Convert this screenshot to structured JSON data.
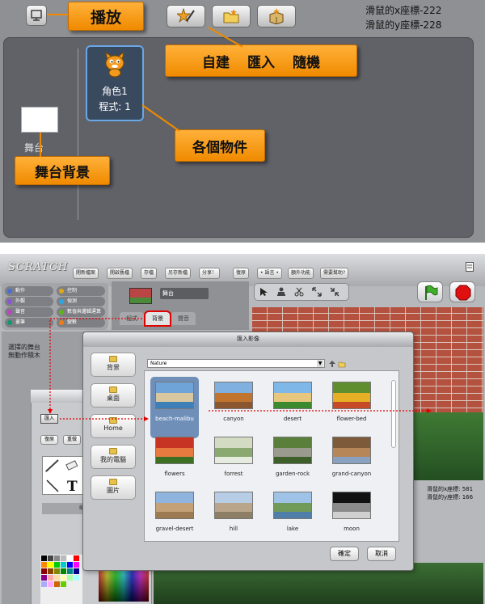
{
  "top": {
    "play_callout": "播放",
    "toolbar_callout": {
      "new": "自建",
      "import": "匯入",
      "random": "隨機"
    },
    "objects_callout": "各個物件",
    "stage_bg_callout": "舞台背景",
    "mouse_x": "滑鼠的x座標-222",
    "mouse_y": "滑鼠的y座標-228",
    "sprite": {
      "name": "角色1",
      "scripts": "程式: 1"
    },
    "stage_label": "舞台"
  },
  "bottom": {
    "logo": "SCRATCH",
    "menu": [
      "開新檔案",
      "開啟舊檔",
      "存檔",
      "另存新檔",
      "分享！",
      "復原",
      "• 語言 •",
      "額外功能",
      "需要幫助?"
    ],
    "categories_left": [
      {
        "label": "動作",
        "color": "#4a6cd4"
      },
      {
        "label": "外觀",
        "color": "#8a55d7"
      },
      {
        "label": "聲音",
        "color": "#bb42c3"
      },
      {
        "label": "畫筆",
        "color": "#0e9a6c"
      }
    ],
    "categories_right": [
      {
        "label": "控制",
        "color": "#e1a91a"
      },
      {
        "label": "偵測",
        "color": "#2ca5e2"
      },
      {
        "label": "數值與邏輯運算",
        "color": "#5cb712"
      },
      {
        "label": "變數",
        "color": "#ee7d16"
      }
    ],
    "stage_name": "舞台",
    "tabs": [
      "程式",
      "背景",
      "聲音"
    ],
    "selected_stage": "選擇的舞台",
    "no_blocks": "無動作積木",
    "import_btn": "匯入",
    "undo_btn": "復原",
    "clear_btn": "重做",
    "zoom_btn": "縮放",
    "mouse_x": "滑鼠的x座標: 581",
    "mouse_y": "滑鼠的y座標: 166",
    "dialog": {
      "title": "匯入影像",
      "folder": "Nature",
      "sidebar": [
        "背景",
        "桌面",
        "Home",
        "我的電腦",
        "圖片"
      ],
      "items": [
        {
          "label": "beach-malibu",
          "colors": [
            "#6fa4d8",
            "#d9c7a0",
            "#3f7fb8"
          ]
        },
        {
          "label": "canyon",
          "colors": [
            "#7fb0e0",
            "#c0742e",
            "#8a5630"
          ]
        },
        {
          "label": "desert",
          "colors": [
            "#7fb7e8",
            "#e6c77d",
            "#3c8a30"
          ]
        },
        {
          "label": "flower-bed",
          "colors": [
            "#5f8e2f",
            "#e5b026",
            "#c64a28"
          ]
        },
        {
          "label": "flowers",
          "colors": [
            "#c83424",
            "#e87a40",
            "#3c6f22"
          ]
        },
        {
          "label": "forrest",
          "colors": [
            "#d3dcc3",
            "#8aa970",
            "#e6ebe0"
          ]
        },
        {
          "label": "garden-rock",
          "colors": [
            "#5a7f3b",
            "#9a9a8e",
            "#3f5f2a"
          ]
        },
        {
          "label": "grand-canyon",
          "colors": [
            "#7c5a3a",
            "#b68658",
            "#8aa0c0"
          ]
        },
        {
          "label": "gravel-desert",
          "colors": [
            "#8fb5de",
            "#c4a176",
            "#9c7a52"
          ]
        },
        {
          "label": "hill",
          "colors": [
            "#b7cde6",
            "#b9a58a",
            "#8c7f66"
          ]
        },
        {
          "label": "lake",
          "colors": [
            "#9fc3e6",
            "#6f9a58",
            "#4f7fa8"
          ]
        },
        {
          "label": "moon",
          "colors": [
            "#111111",
            "#8a8a8a",
            "#cfcfcf"
          ]
        }
      ],
      "ok": "確定",
      "cancel": "取消"
    }
  }
}
